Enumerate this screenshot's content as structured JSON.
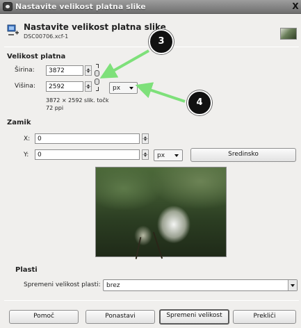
{
  "window": {
    "title": "Nastavite velikost platna slike",
    "close_glyph": "X"
  },
  "header": {
    "title": "Nastavite velikost platna slike",
    "filename": "DSC00706.xcf-1"
  },
  "canvas_size": {
    "section_label": "Velikost platna",
    "width_label": "Širina:",
    "width_value": "3872",
    "height_label": "Višina:",
    "height_value": "2592",
    "unit": "px",
    "info_line1": "3872 × 2592 slik. točk",
    "info_line2": "72 ppi"
  },
  "offset": {
    "section_label": "Zamik",
    "x_label": "X:",
    "x_value": "0",
    "y_label": "Y:",
    "y_value": "0",
    "unit": "px",
    "center_button": "Sredinsko"
  },
  "layers": {
    "section_label": "Plasti",
    "resize_label": "Spremeni velikost plasti:",
    "resize_value": "brez"
  },
  "buttons": {
    "help": "Pomoč",
    "reset": "Ponastavi",
    "resize": "Spremeni velikost",
    "cancel": "Prekliči"
  },
  "annotations": {
    "callout_3": "3",
    "callout_4": "4",
    "arrow_color": "#7ee07a"
  }
}
